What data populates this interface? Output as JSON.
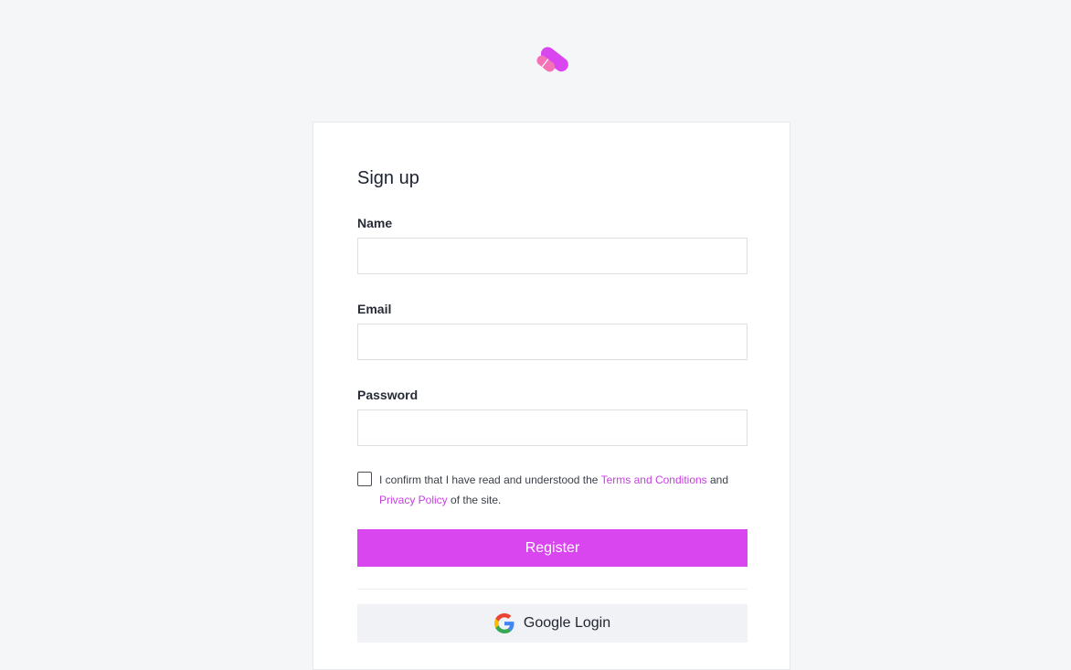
{
  "brand": {
    "logo_icon": "pill-capsule-icon",
    "logo_colors": [
      "#d946ef",
      "#f472b6"
    ]
  },
  "form": {
    "title": "Sign up",
    "fields": {
      "name": {
        "label": "Name",
        "value": "",
        "placeholder": ""
      },
      "email": {
        "label": "Email",
        "value": "",
        "placeholder": ""
      },
      "password": {
        "label": "Password",
        "value": "",
        "placeholder": ""
      }
    },
    "confirm": {
      "checked": false,
      "text_before": "I confirm that I have read and understood the ",
      "terms_link": "Terms and Conditions",
      "text_middle": " and",
      "privacy_link": "Privacy Policy",
      "text_after": " of the site."
    },
    "register_label": "Register",
    "google_label": "Google Login",
    "google_icon": "google-logo-icon"
  },
  "colors": {
    "accent": "#d946ef",
    "link": "#c73ee0",
    "background": "#f5f6f8",
    "secondary_button": "#f1f2f5"
  }
}
